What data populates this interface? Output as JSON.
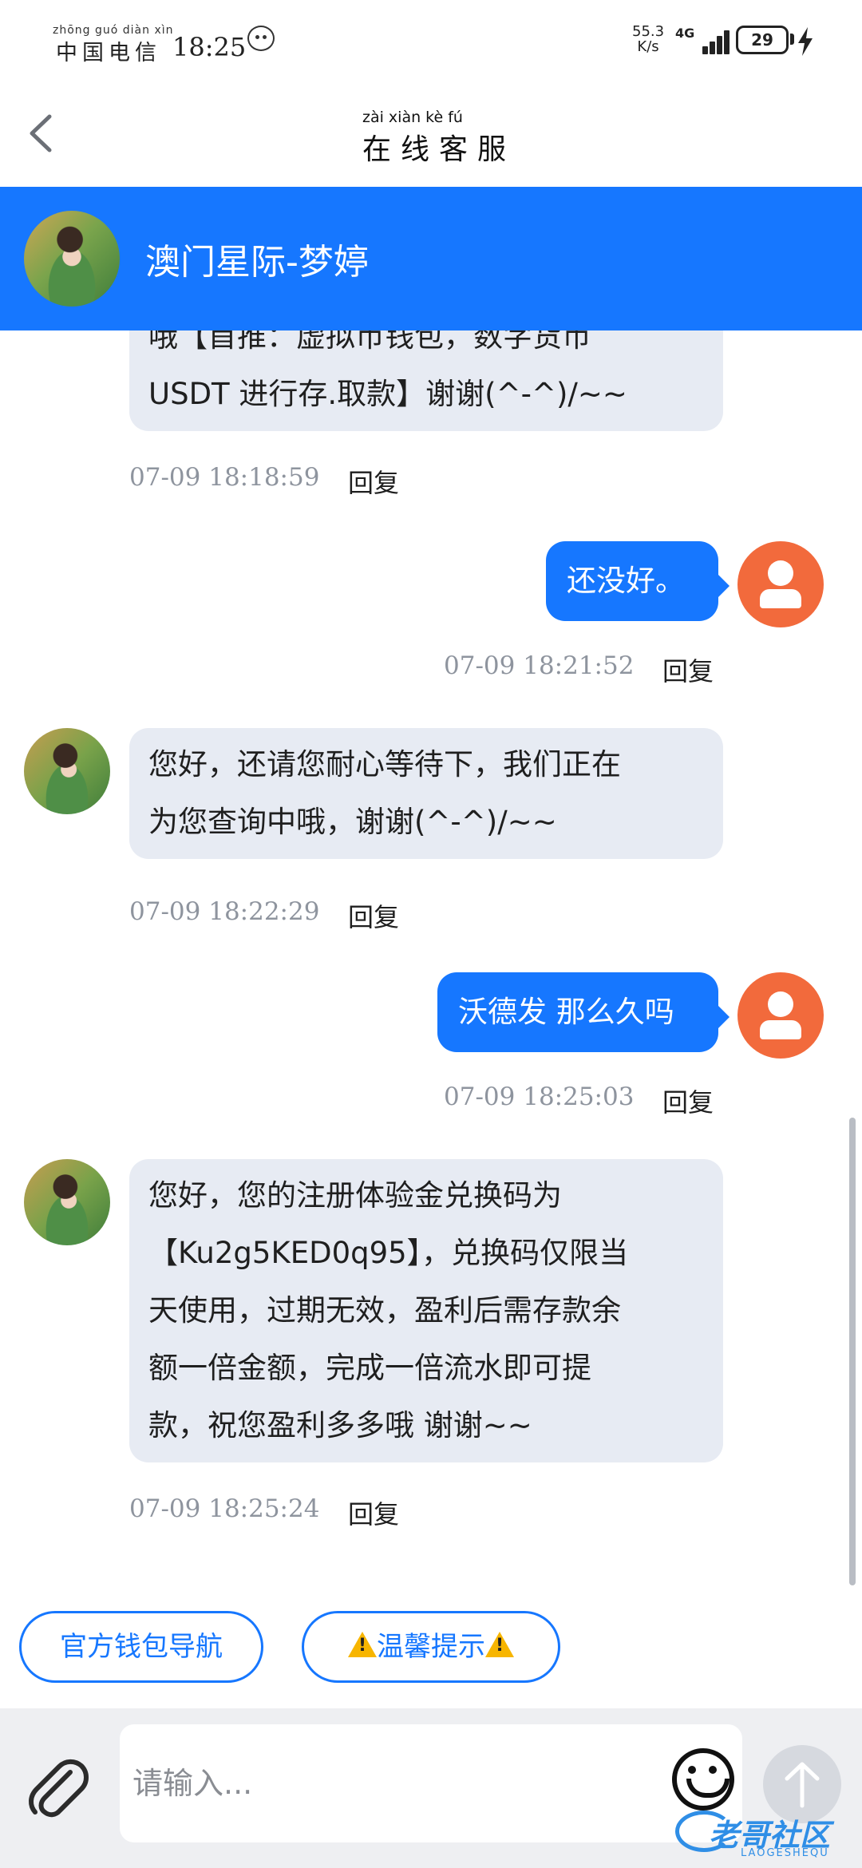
{
  "status_bar": {
    "carrier_pinyin": "zhōng guó diàn xìn",
    "carrier": "中国电信",
    "time": "18:25",
    "net_speed_value": "55.3",
    "net_speed_unit": "K/s",
    "network_type": "4G",
    "battery": "29"
  },
  "header": {
    "title_pinyin": "zài xiàn kè fú",
    "title": "在线客服"
  },
  "agent": {
    "name": "澳门星际-梦婷"
  },
  "messages": [
    {
      "sender": "agent",
      "lines": [
        "哦【首推：虚拟币钱包，数字货币",
        "USDT 进行存.取款】谢谢(^-^)/~~"
      ],
      "time": "07-09 18:18:59",
      "reply_label": "回复"
    },
    {
      "sender": "user",
      "lines": [
        "还没好。"
      ],
      "time": "07-09 18:21:52",
      "reply_label": "回复"
    },
    {
      "sender": "agent",
      "lines": [
        "您好，还请您耐心等待下，我们正在",
        "为您查询中哦，谢谢(^-^)/~~"
      ],
      "time": "07-09 18:22:29",
      "reply_label": "回复"
    },
    {
      "sender": "user",
      "lines": [
        "沃德发 那么久吗"
      ],
      "time": "07-09 18:25:03",
      "reply_label": "回复"
    },
    {
      "sender": "agent",
      "lines": [
        "您好，您的注册体验金兑换码为",
        "【Ku2g5KED0q95】，兑换码仅限当",
        "天使用，过期无效，盈利后需存款余",
        "额一倍金额，完成一倍流水即可提",
        "款，祝您盈利多多哦 谢谢~~"
      ],
      "time": "07-09 18:25:24",
      "reply_label": "回复"
    }
  ],
  "quick_actions": {
    "wallet_nav": "官方钱包导航",
    "tips": "温馨提示"
  },
  "input": {
    "placeholder": "请输入..."
  },
  "watermark": {
    "text": "老哥社区",
    "sub": "LAOGESHEQU"
  },
  "colors": {
    "brand_blue": "#1677ff",
    "incoming_bubble": "#e7ebf3",
    "user_avatar": "#f26a3c",
    "timestamp": "#8e949e"
  },
  "icons": {
    "back": "chevron-left-icon",
    "attach": "paperclip-icon",
    "emoji": "smiley-icon",
    "send": "arrow-up-icon",
    "warning": "warning-icon",
    "user_avatar": "person-icon"
  }
}
